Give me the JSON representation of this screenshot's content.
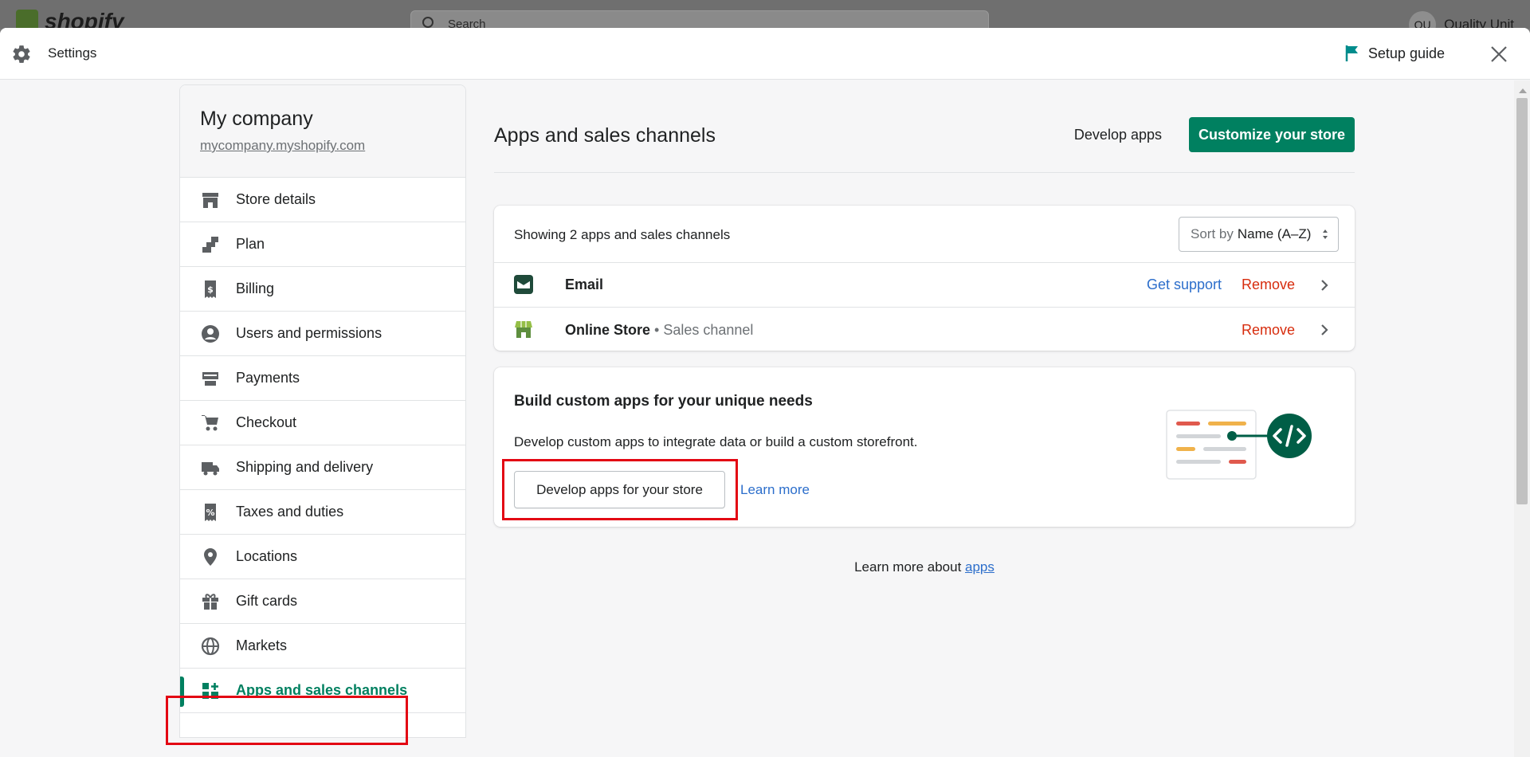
{
  "topbar": {
    "logo_text": "shopify",
    "search_placeholder": "Search",
    "user_initials": "QU",
    "user_name": "Quality Unit"
  },
  "header": {
    "title": "Settings",
    "setup_guide": "Setup guide"
  },
  "sidebar": {
    "company_name": "My company",
    "company_url": "mycompany.myshopify.com",
    "items": [
      {
        "label": "Store details",
        "icon": "store-icon"
      },
      {
        "label": "Plan",
        "icon": "plan-icon"
      },
      {
        "label": "Billing",
        "icon": "billing-icon"
      },
      {
        "label": "Users and permissions",
        "icon": "user-icon"
      },
      {
        "label": "Payments",
        "icon": "payments-icon"
      },
      {
        "label": "Checkout",
        "icon": "cart-icon"
      },
      {
        "label": "Shipping and delivery",
        "icon": "truck-icon"
      },
      {
        "label": "Taxes and duties",
        "icon": "tax-icon"
      },
      {
        "label": "Locations",
        "icon": "location-icon"
      },
      {
        "label": "Gift cards",
        "icon": "gift-icon"
      },
      {
        "label": "Markets",
        "icon": "globe-icon"
      },
      {
        "label": "Apps and sales channels",
        "icon": "apps-icon",
        "active": true
      }
    ]
  },
  "main": {
    "title": "Apps and sales channels",
    "develop_apps": "Develop apps",
    "customize_store": "Customize your store",
    "apps_card": {
      "showing": "Showing 2 apps and sales channels",
      "sort_prefix": "Sort by",
      "sort_value": "Name (A–Z)",
      "apps": [
        {
          "name": "Email",
          "subtitle": "",
          "get_support": "Get support",
          "remove": "Remove"
        },
        {
          "name": "Online Store",
          "subtitle": " • Sales channel",
          "get_support": "",
          "remove": "Remove"
        }
      ]
    },
    "custom_card": {
      "title": "Build custom apps for your unique needs",
      "description": "Develop custom apps to integrate data or build a custom storefront.",
      "button": "Develop apps for your store",
      "learn_more": "Learn more"
    },
    "footer": {
      "text": "Learn more about ",
      "link": "apps"
    }
  },
  "colors": {
    "accent": "#008060",
    "link": "#2c6ecb",
    "critical": "#d72c0d",
    "highlight": "#e30613"
  }
}
